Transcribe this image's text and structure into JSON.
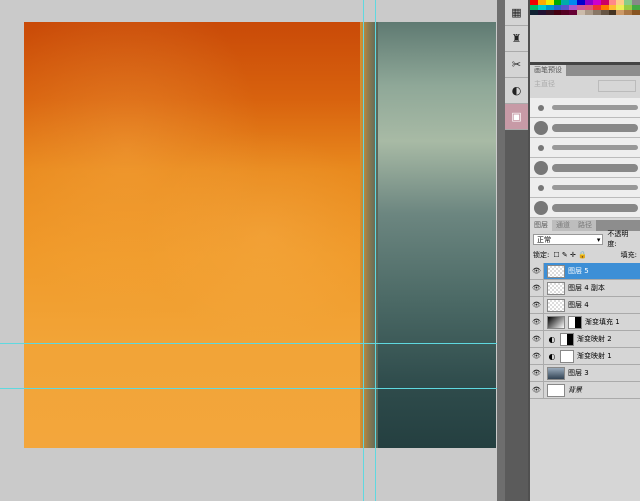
{
  "brush_panel": {
    "tab": "画笔预设",
    "diameter_label": "主直径"
  },
  "layers_panel": {
    "tabs": [
      "图层",
      "通道",
      "路径"
    ],
    "blend_mode": "正常",
    "opacity_label": "不透明度:",
    "lock_label": "锁定:",
    "lock_icons": "☐ ✎ ✛ 🔒",
    "fill_label": "填充:",
    "layers": [
      {
        "name": "图层 5",
        "type": "pixel",
        "active": true
      },
      {
        "name": "图层 4 副本",
        "type": "pixel"
      },
      {
        "name": "图层 4",
        "type": "pixel"
      },
      {
        "name": "渐变填充 1",
        "type": "gradient-fill"
      },
      {
        "name": "渐变映射 2",
        "type": "gradient-map"
      },
      {
        "name": "渐变映射 1",
        "type": "gradient-map"
      },
      {
        "name": "图层 3",
        "type": "photo"
      },
      {
        "name": "背景",
        "type": "background"
      }
    ]
  },
  "colors": {
    "accent": "#3d8fd6",
    "guide": "#5fd8e0"
  }
}
